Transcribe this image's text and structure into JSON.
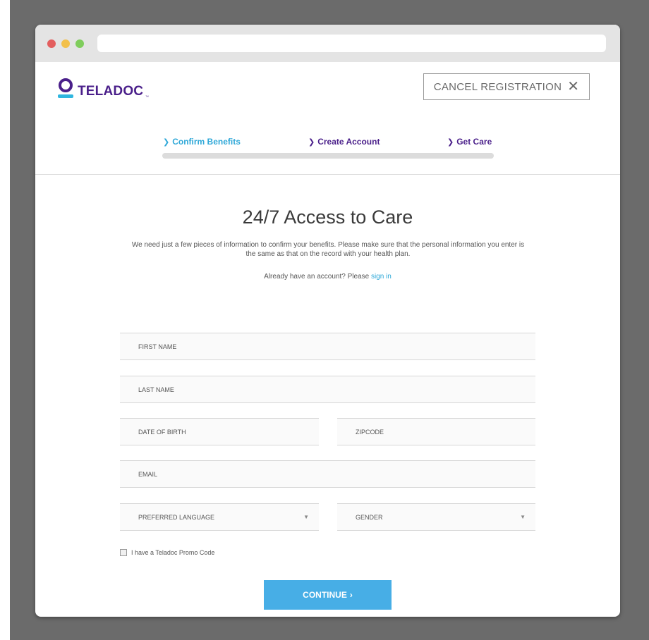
{
  "header": {
    "logo_text": "TELADOC",
    "logo_tm": "™",
    "cancel_label": "CANCEL REGISTRATION",
    "cancel_icon": "✕"
  },
  "steps": [
    {
      "label": "Confirm Benefits",
      "active": true
    },
    {
      "label": "Create Account",
      "active": false
    },
    {
      "label": "Get Care",
      "active": false
    }
  ],
  "main": {
    "title": "24/7 Access to Care",
    "subtitle": "We need just a few pieces of information to confirm your benefits. Please make sure that the personal information you enter is the same as that on the record with your health plan.",
    "signin_prefix": "Already have an account? Please ",
    "signin_link": "sign in"
  },
  "form": {
    "first_name": {
      "placeholder": "FIRST NAME",
      "value": ""
    },
    "last_name": {
      "placeholder": "LAST NAME",
      "value": ""
    },
    "dob": {
      "placeholder": "DATE OF BIRTH",
      "value": ""
    },
    "zipcode": {
      "placeholder": "ZIPCODE",
      "value": ""
    },
    "email": {
      "placeholder": "EMAIL",
      "value": ""
    },
    "language": {
      "label": "PREFERRED LANGUAGE"
    },
    "gender": {
      "label": "GENDER"
    },
    "promo_label": "I have a Teladoc Promo Code",
    "continue_label": "CONTINUE",
    "continue_chevron": "›"
  },
  "colors": {
    "brand_purple": "#4a1f8a",
    "accent_blue": "#2fa8d8",
    "button_blue": "#47aee6"
  },
  "icons": {
    "chevron": "chevron-right-icon",
    "caret": "caret-down-icon",
    "close": "close-icon"
  }
}
